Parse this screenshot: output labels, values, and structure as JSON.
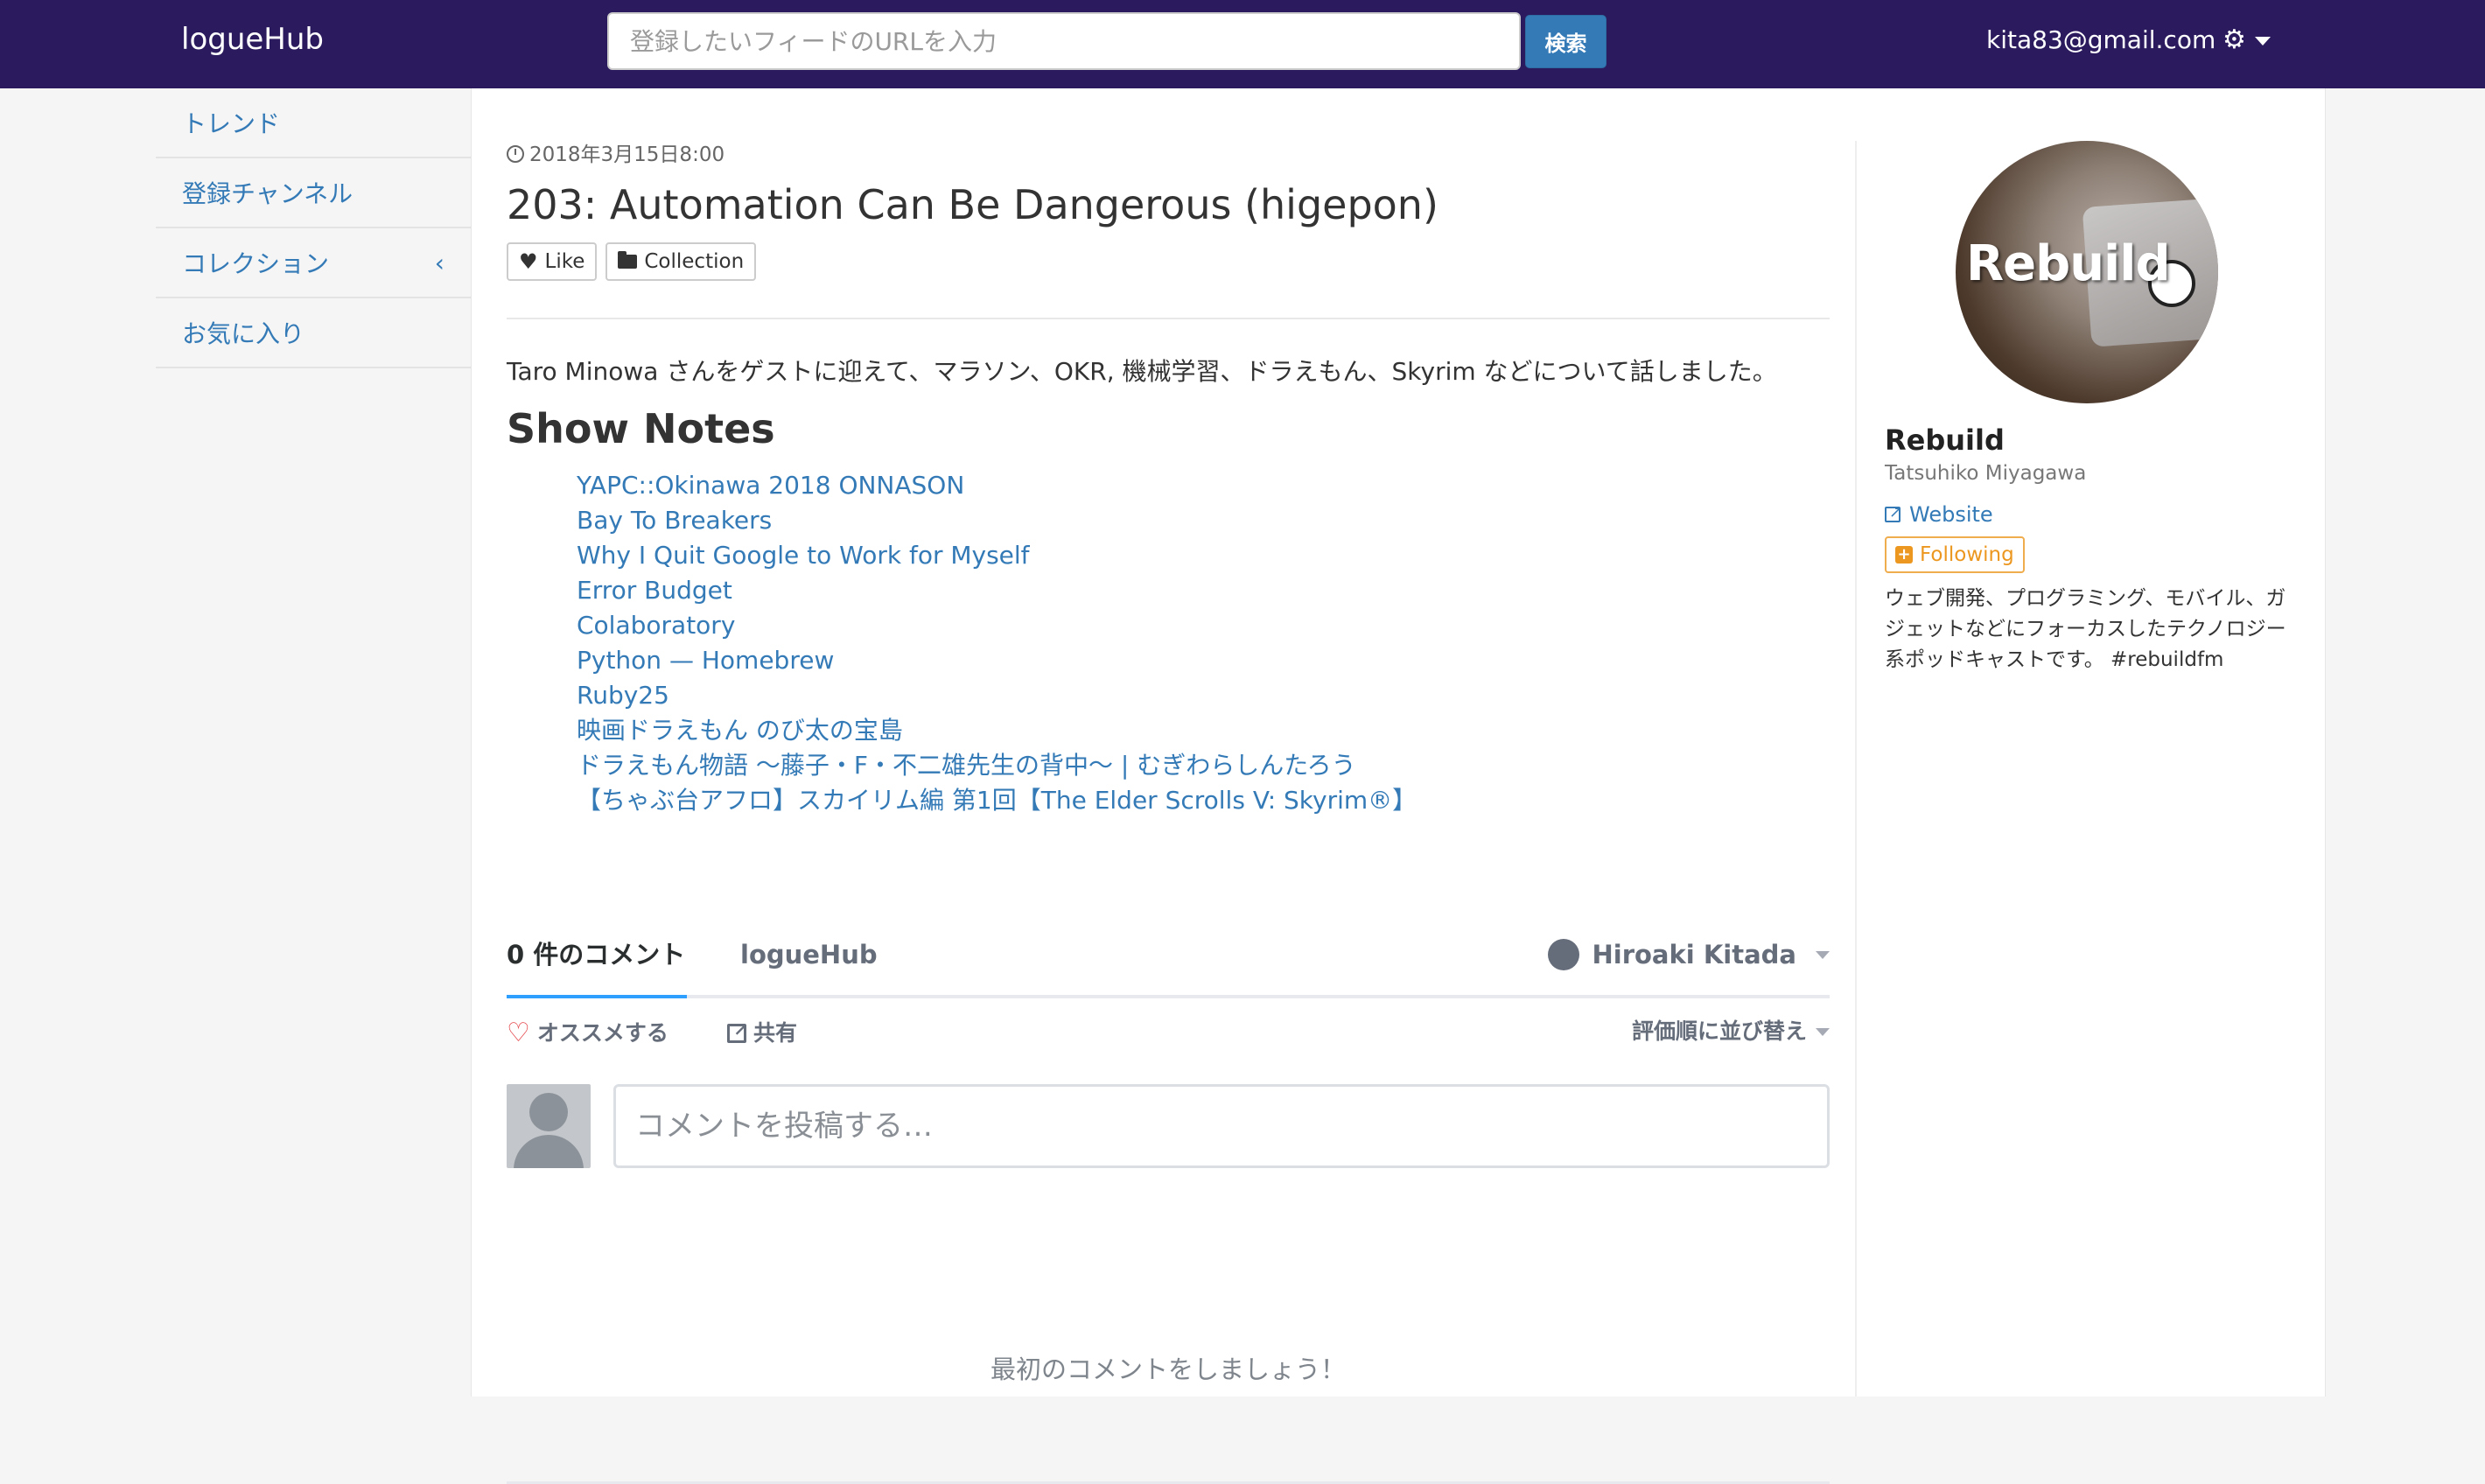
{
  "app": {
    "brand": "logueHub",
    "search_placeholder": "登録したいフィードのURLを入力",
    "search_button": "検索",
    "user_email": "kita83@gmail.com",
    "settings_icon": "gear-icon"
  },
  "sidebar": {
    "items": [
      {
        "label": "トレンド"
      },
      {
        "label": "登録チャンネル"
      },
      {
        "label": "コレクション",
        "chevron": "‹"
      },
      {
        "label": "お気に入り"
      }
    ]
  },
  "episode": {
    "date": "2018年3月15日8:00",
    "title": "203: Automation Can Be Dangerous (higepon)",
    "like_label": "Like",
    "collection_label": "Collection",
    "description": "Taro Minowa さんをゲストに迎えて、マラソン、OKR, 機械学習、ドラえもん、Skyrim などについて話しました。",
    "show_notes_title": "Show Notes",
    "show_notes": [
      "YAPC::Okinawa 2018 ONNASON",
      "Bay To Breakers",
      "Why I Quit Google to Work for Myself",
      "Error Budget",
      "Colaboratory",
      "Python — Homebrew",
      "Ruby25",
      "映画ドラえもん のび太の宝島",
      "ドラえもん物語 〜藤子・F・不二雄先生の背中〜 | むぎわらしんたろう",
      "【ちゃぶ台アフロ】スカイリム編 第1回【The Elder Scrolls V: Skyrim®】"
    ]
  },
  "comments": {
    "count_tab": "0 件のコメント",
    "site_tab": "logueHub",
    "user_name": "Hiroaki Kitada",
    "recommend": "オススメする",
    "share": "共有",
    "sort": "評価順に並び替え",
    "input_placeholder": "コメントを投稿する…",
    "empty_message": "最初のコメントをしましょう！"
  },
  "channel": {
    "art_text": "Rebuild",
    "name": "Rebuild",
    "author": "Tatsuhiko Miyagawa",
    "website": "Website",
    "follow": "Following",
    "description": "ウェブ開発、プログラミング、モバイル、ガジェットなどにフォーカスしたテクノロジー系ポッドキャストです。 #rebuildfm"
  },
  "colors": {
    "navbar": "#2b1a5e",
    "link": "#337ab7",
    "follow": "#ec971f",
    "tab_accent": "#2e9fff"
  }
}
